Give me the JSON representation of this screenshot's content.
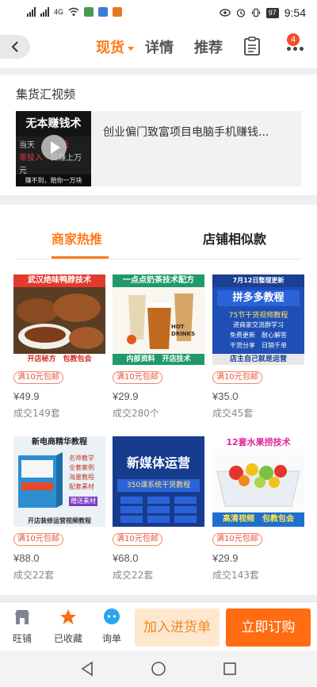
{
  "status_bar": {
    "network": "4G",
    "battery": "97",
    "time": "9:54"
  },
  "nav": {
    "tabs": [
      "现货",
      "详情",
      "推荐"
    ],
    "active_tab": "现货",
    "notification_count": "4",
    "accent_color": "#ff7a1a"
  },
  "video_section": {
    "title": "集货汇视频",
    "video": {
      "title": "创业偏门致富项目电脑手机赚钱...",
      "thumb_top": "无本赚钱术",
      "thumb_mid_1": "当天",
      "thumb_mid_2": "0元",
      "thumb_mid_3": "零投入",
      "thumb_mid_4": "日赚上万元",
      "thumb_bottom": "赚不到，赔你一万块"
    }
  },
  "products_section": {
    "tabs": [
      "商家热推",
      "店铺相似款"
    ],
    "active_tab": "商家热推",
    "items": [
      {
        "image_banner": "武汉绝味鸭脖技术",
        "image_footer": "开店秘方　包教包会",
        "promo": "满10元包邮",
        "price": "¥49.9",
        "sold": "成交149套"
      },
      {
        "image_banner": "一点点奶茶技术配方",
        "image_mid": "HOT DRINKS",
        "image_footer": "内部资料　开店技术",
        "promo": "满10元包邮",
        "price": "¥29.9",
        "sold": "成交280个"
      },
      {
        "image_banner": "7月12日整理更新",
        "image_title": "拼多多教程",
        "image_sub": "75节干货视频教程",
        "image_l1": "进商家交流群学习",
        "image_l2": "免费更新　耐心解答",
        "image_l3": "干货分享　日销千单",
        "image_footer": "店主自己就是运营",
        "promo": "满10元包邮",
        "price": "¥35.0",
        "sold": "成交45套"
      },
      {
        "image_banner": "新电商精华教程",
        "image_l1": "名师教学",
        "image_l2": "全套案例",
        "image_l3": "海量教程",
        "image_l4": "配套素材",
        "image_tag": "赠送素材",
        "image_footer": "开店装修运营视频教程",
        "promo": "满10元包邮",
        "price": "¥88.0",
        "sold": "成交22套"
      },
      {
        "image_title": "新媒体运营",
        "image_sub": "350课系统干货教程",
        "promo": "满10元包邮",
        "price": "¥68.0",
        "sold": "成交22套"
      },
      {
        "image_banner": "12套水果捞技术",
        "image_footer": "高清视频　包教包会",
        "promo": "满10元包邮",
        "price": "¥29.9",
        "sold": "成交143套"
      }
    ]
  },
  "bottom_bar": {
    "icons": [
      {
        "label": "旺铺"
      },
      {
        "label": "已收藏"
      },
      {
        "label": "询单"
      }
    ],
    "add_button": "加入进货单",
    "buy_button": "立即订购"
  }
}
